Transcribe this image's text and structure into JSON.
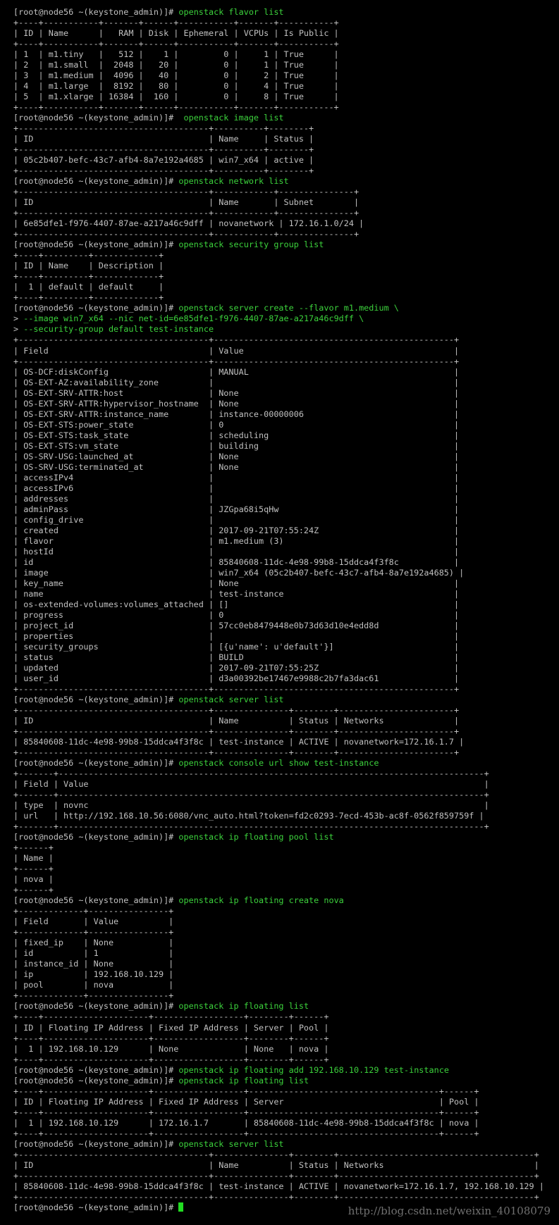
{
  "colors": {
    "background": "#000000",
    "output_text": "#c0c0c0",
    "command_text": "#3cd23c",
    "cursor": "#22dd22"
  },
  "terminal": {
    "lines": [
      {
        "prompt": "[root@node56 ~(keystone_admin)]# ",
        "cmd": "openstack flavor list"
      },
      {
        "text": "+----+-----------+-------+------+-----------+-------+-----------+"
      },
      {
        "text": "| ID | Name      |   RAM | Disk | Ephemeral | VCPUs | Is Public |"
      },
      {
        "text": "+----+-----------+-------+------+-----------+-------+-----------+"
      },
      {
        "text": "| 1  | m1.tiny   |   512 |    1 |         0 |     1 | True      |"
      },
      {
        "text": "| 2  | m1.small  |  2048 |   20 |         0 |     1 | True      |"
      },
      {
        "text": "| 3  | m1.medium |  4096 |   40 |         0 |     2 | True      |"
      },
      {
        "text": "| 4  | m1.large  |  8192 |   80 |         0 |     4 | True      |"
      },
      {
        "text": "| 5  | m1.xlarge | 16384 |  160 |         0 |     8 | True      |"
      },
      {
        "text": "+----+-----------+-------+------+-----------+-------+-----------+"
      },
      {
        "prompt": "[root@node56 ~(keystone_admin)]# ",
        "cmd": " openstack image list"
      },
      {
        "text": "+--------------------------------------+----------+--------+"
      },
      {
        "text": "| ID                                   | Name     | Status |"
      },
      {
        "text": "+--------------------------------------+----------+--------+"
      },
      {
        "text": "| 05c2b407-befc-43c7-afb4-8a7e192a4685 | win7_x64 | active |"
      },
      {
        "text": "+--------------------------------------+----------+--------+"
      },
      {
        "prompt": "[root@node56 ~(keystone_admin)]# ",
        "cmd": "openstack network list"
      },
      {
        "text": "+--------------------------------------+------------+---------------+"
      },
      {
        "text": "| ID                                   | Name       | Subnet        |"
      },
      {
        "text": "+--------------------------------------+------------+---------------+"
      },
      {
        "text": "| 6e85dfe1-f976-4407-87ae-a217a46c9dff | novanetwork | 172.16.1.0/24 |"
      },
      {
        "text": "+--------------------------------------+------------+---------------+"
      },
      {
        "prompt": "[root@node56 ~(keystone_admin)]# ",
        "cmd": "openstack security group list"
      },
      {
        "text": "+----+---------+-------------+"
      },
      {
        "text": "| ID | Name    | Description |"
      },
      {
        "text": "+----+---------+-------------+"
      },
      {
        "text": "|  1 | default | default     |"
      },
      {
        "text": "+----+---------+-------------+"
      },
      {
        "prompt": "[root@node56 ~(keystone_admin)]# ",
        "cmd": "openstack server create --flavor m1.medium \\"
      },
      {
        "prompt": "> ",
        "cmd": "--image win7_x64 --nic net-id=6e85dfe1-f976-4407-87ae-a217a46c9dff \\"
      },
      {
        "prompt": "> ",
        "cmd": "--security-group default test-instance"
      },
      {
        "text": "+--------------------------------------+------------------------------------------------+"
      },
      {
        "text": "| Field                                | Value                                          |"
      },
      {
        "text": "+--------------------------------------+------------------------------------------------+"
      },
      {
        "text": "| OS-DCF:diskConfig                    | MANUAL                                         |"
      },
      {
        "text": "| OS-EXT-AZ:availability_zone          |                                                |"
      },
      {
        "text": "| OS-EXT-SRV-ATTR:host                 | None                                           |"
      },
      {
        "text": "| OS-EXT-SRV-ATTR:hypervisor_hostname  | None                                           |"
      },
      {
        "text": "| OS-EXT-SRV-ATTR:instance_name        | instance-00000006                              |"
      },
      {
        "text": "| OS-EXT-STS:power_state               | 0                                              |"
      },
      {
        "text": "| OS-EXT-STS:task_state                | scheduling                                     |"
      },
      {
        "text": "| OS-EXT-STS:vm_state                  | building                                       |"
      },
      {
        "text": "| OS-SRV-USG:launched_at               | None                                           |"
      },
      {
        "text": "| OS-SRV-USG:terminated_at             | None                                           |"
      },
      {
        "text": "| accessIPv4                           |                                                |"
      },
      {
        "text": "| accessIPv6                           |                                                |"
      },
      {
        "text": "| addresses                            |                                                |"
      },
      {
        "text": "| adminPass                            | JZGpa68i5qHw                                   |"
      },
      {
        "text": "| config_drive                         |                                                |"
      },
      {
        "text": "| created                              | 2017-09-21T07:55:24Z                           |"
      },
      {
        "text": "| flavor                               | m1.medium (3)                                  |"
      },
      {
        "text": "| hostId                               |                                                |"
      },
      {
        "text": "| id                                   | 85840608-11dc-4e98-99b8-15ddca4f3f8c           |"
      },
      {
        "text": "| image                                | win7_x64 (05c2b407-befc-43c7-afb4-8a7e192a4685) |"
      },
      {
        "text": "| key_name                             | None                                           |"
      },
      {
        "text": "| name                                 | test-instance                                  |"
      },
      {
        "text": "| os-extended-volumes:volumes_attached | []                                             |"
      },
      {
        "text": "| progress                             | 0                                              |"
      },
      {
        "text": "| project_id                           | 57cc0eb8479448e0b73d63d10e4edd8d               |"
      },
      {
        "text": "| properties                           |                                                |"
      },
      {
        "text": "| security_groups                      | [{u'name': u'default'}]                        |"
      },
      {
        "text": "| status                               | BUILD                                          |"
      },
      {
        "text": "| updated                              | 2017-09-21T07:55:25Z                           |"
      },
      {
        "text": "| user_id                              | d3a00392be17467e9988c2b7fa3dac61               |"
      },
      {
        "text": "+--------------------------------------+------------------------------------------------+"
      },
      {
        "prompt": "[root@node56 ~(keystone_admin)]# ",
        "cmd": "openstack server list"
      },
      {
        "text": "+--------------------------------------+---------------+--------+-----------------------+"
      },
      {
        "text": "| ID                                   | Name          | Status | Networks              |"
      },
      {
        "text": "+--------------------------------------+---------------+--------+-----------------------+"
      },
      {
        "text": "| 85840608-11dc-4e98-99b8-15ddca4f3f8c | test-instance | ACTIVE | novanetwork=172.16.1.7 |"
      },
      {
        "text": "+--------------------------------------+---------------+--------+-----------------------+"
      },
      {
        "prompt": "[root@node56 ~(keystone_admin)]# ",
        "cmd": "openstack console url show test-instance"
      },
      {
        "text": "+-------+-------------------------------------------------------------------------------------+"
      },
      {
        "text": "| Field | Value                                                                               |"
      },
      {
        "text": "+-------+-------------------------------------------------------------------------------------+"
      },
      {
        "text": "| type  | novnc                                                                               |"
      },
      {
        "text": "| url   | http://192.168.10.56:6080/vnc_auto.html?token=fd2c0293-7ecd-453b-ac8f-0562f859759f |"
      },
      {
        "text": "+-------+-------------------------------------------------------------------------------------+"
      },
      {
        "prompt": "[root@node56 ~(keystone_admin)]# ",
        "cmd": "openstack ip floating pool list"
      },
      {
        "text": "+------+"
      },
      {
        "text": "| Name |"
      },
      {
        "text": "+------+"
      },
      {
        "text": "| nova |"
      },
      {
        "text": "+------+"
      },
      {
        "prompt": "[root@node56 ~(keystone_admin)]# ",
        "cmd": "openstack ip floating create nova"
      },
      {
        "text": "+-------------+----------------+"
      },
      {
        "text": "| Field       | Value          |"
      },
      {
        "text": "+-------------+----------------+"
      },
      {
        "text": "| fixed_ip    | None           |"
      },
      {
        "text": "| id          | 1              |"
      },
      {
        "text": "| instance_id | None           |"
      },
      {
        "text": "| ip          | 192.168.10.129 |"
      },
      {
        "text": "| pool        | nova           |"
      },
      {
        "text": "+-------------+----------------+"
      },
      {
        "prompt": "[root@node56 ~(keystone_admin)]# ",
        "cmd": "openstack ip floating list"
      },
      {
        "text": "+----+---------------------+------------------+--------+------+"
      },
      {
        "text": "| ID | Floating IP Address | Fixed IP Address | Server | Pool |"
      },
      {
        "text": "+----+---------------------+------------------+--------+------+"
      },
      {
        "text": "|  1 | 192.168.10.129      | None             | None   | nova |"
      },
      {
        "text": "+----+---------------------+------------------+--------+------+"
      },
      {
        "prompt": "[root@node56 ~(keystone_admin)]# ",
        "cmd": "openstack ip floating add 192.168.10.129 test-instance"
      },
      {
        "prompt": "[root@node56 ~(keystone_admin)]# ",
        "cmd": "openstack ip floating list"
      },
      {
        "text": "+----+---------------------+------------------+--------------------------------------+------+"
      },
      {
        "text": "| ID | Floating IP Address | Fixed IP Address | Server                               | Pool |"
      },
      {
        "text": "+----+---------------------+------------------+--------------------------------------+------+"
      },
      {
        "text": "|  1 | 192.168.10.129      | 172.16.1.7       | 85840608-11dc-4e98-99b8-15ddca4f3f8c | nova |"
      },
      {
        "text": "+----+---------------------+------------------+--------------------------------------+------+"
      },
      {
        "prompt": "[root@node56 ~(keystone_admin)]# ",
        "cmd": "openstack server list"
      },
      {
        "text": "+--------------------------------------+---------------+--------+---------------------------------------+"
      },
      {
        "text": "| ID                                   | Name          | Status | Networks                              |"
      },
      {
        "text": "+--------------------------------------+---------------+--------+---------------------------------------+"
      },
      {
        "text": "| 85840608-11dc-4e98-99b8-15ddca4f3f8c | test-instance | ACTIVE | novanetwork=172.16.1.7, 192.168.10.129 |"
      },
      {
        "text": "+--------------------------------------+---------------+--------+---------------------------------------+"
      },
      {
        "prompt": "[root@node56 ~(keystone_admin)]# ",
        "cmd": "",
        "cursor": true
      }
    ]
  },
  "watermark": "http://blog.csdn.net/weixin_40108079"
}
